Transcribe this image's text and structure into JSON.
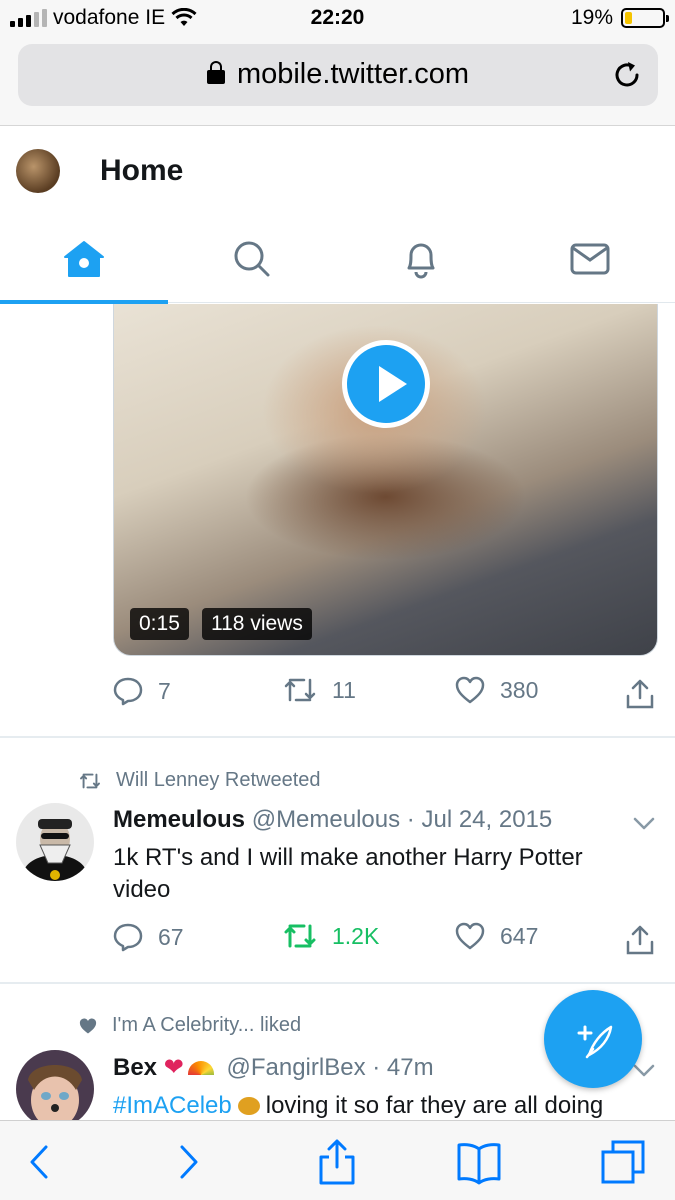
{
  "status_bar": {
    "carrier": "vodafone IE",
    "time": "22:20",
    "battery_text": "19%",
    "battery_level": 0.19
  },
  "browser": {
    "url": "mobile.twitter.com"
  },
  "header": {
    "title": "Home"
  },
  "tabs": [
    {
      "name": "home",
      "active": true
    },
    {
      "name": "search",
      "active": false
    },
    {
      "name": "notifications",
      "active": false
    },
    {
      "name": "messages",
      "active": false
    }
  ],
  "tweet1": {
    "video_duration": "0:15",
    "video_views": "118 views",
    "replies": "7",
    "retweets": "11",
    "likes": "380"
  },
  "tweet2": {
    "context": "Will Lenney Retweeted",
    "name": "Memeulous",
    "handle": "@Memeulous",
    "date": "Jul 24, 2015",
    "text": "1k RT's and I will make another Harry Potter video",
    "replies": "67",
    "retweets": "1.2K",
    "likes": "647"
  },
  "tweet3": {
    "context": "I'm A Celebrity... liked",
    "name": "Bex",
    "handle": "@FangirlBex",
    "time": "47m",
    "hashtag": "#ImACeleb",
    "text_rest": "loving it so far they are all doing"
  },
  "colors": {
    "accent": "#1da1f2",
    "retweet_green": "#17bf63",
    "muted": "#657786"
  }
}
